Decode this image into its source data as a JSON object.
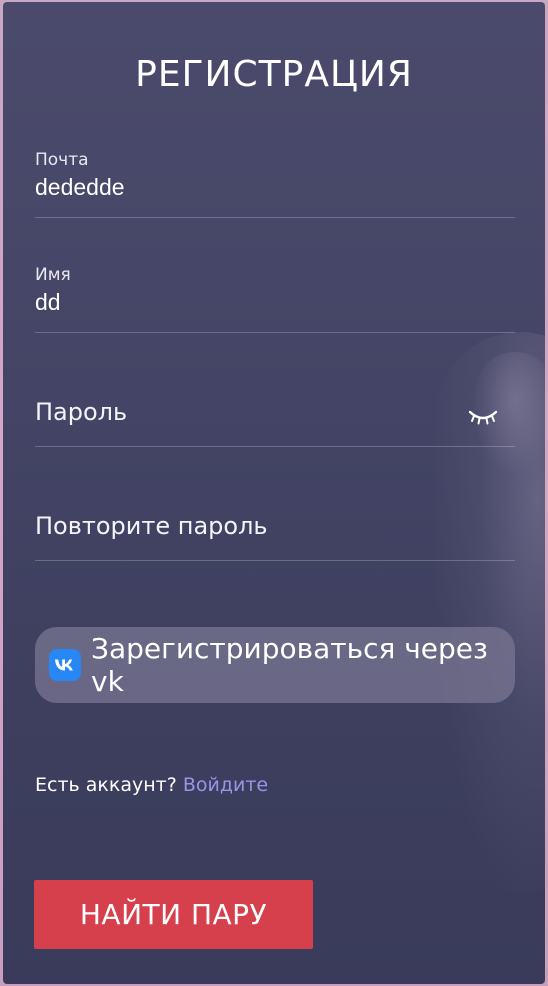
{
  "form": {
    "title": "РЕГИСТРАЦИЯ",
    "email": {
      "label": "Почта",
      "value": "dededde"
    },
    "name": {
      "label": "Имя",
      "value": "dd"
    },
    "password": {
      "placeholder": "Пароль",
      "icon": "eye-closed-icon"
    },
    "password_repeat": {
      "placeholder": "Повторите пароль"
    },
    "vk_button": {
      "label": "Зарегистрироваться через vk",
      "icon": "vk-logo-icon",
      "color": "#2787f5"
    },
    "login_prompt": {
      "text": "Есть аккаунт?",
      "link": "Войдите"
    },
    "submit": {
      "label": "НАЙТИ ПАРУ",
      "color": "#d63f4c"
    }
  }
}
